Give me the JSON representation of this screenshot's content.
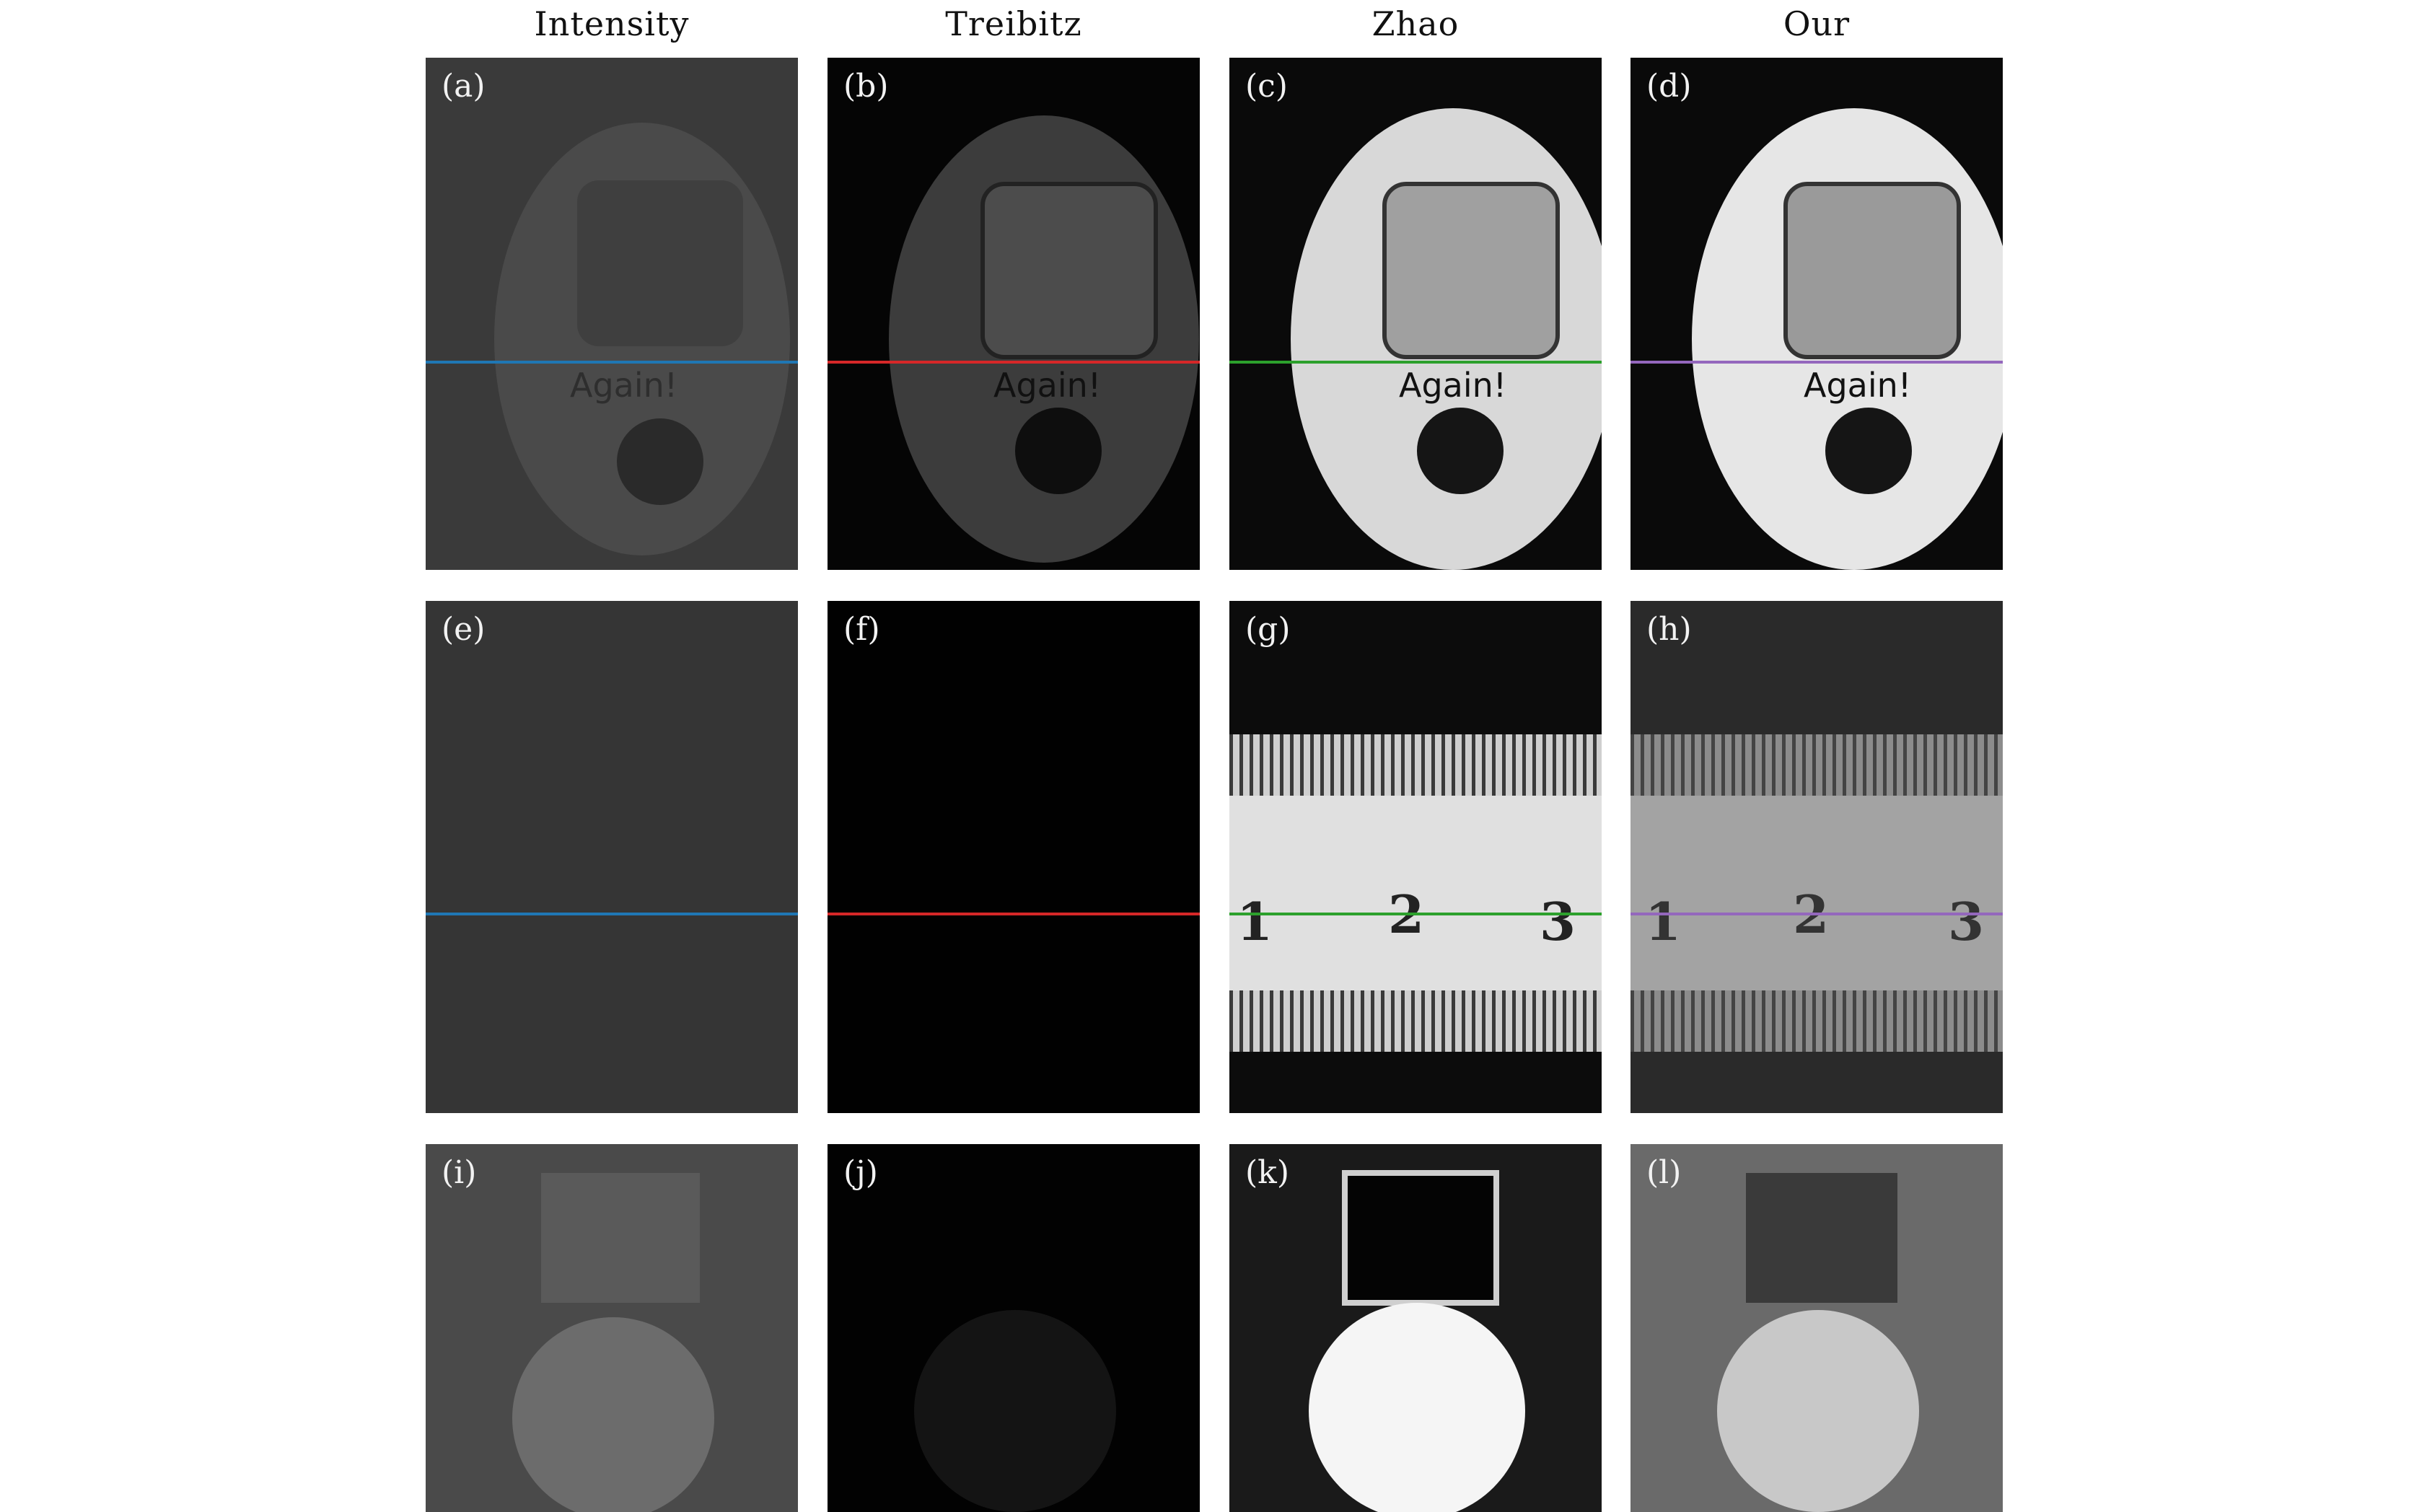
{
  "columns": [
    "Intensity",
    "Treibitz",
    "Zhao",
    "Our"
  ],
  "panels": [
    {
      "label": "(a)"
    },
    {
      "label": "(b)"
    },
    {
      "label": "(c)"
    },
    {
      "label": "(d)"
    },
    {
      "label": "(e)"
    },
    {
      "label": "(f)"
    },
    {
      "label": "(g)"
    },
    {
      "label": "(h)"
    },
    {
      "label": "(i)"
    },
    {
      "label": "(j)"
    },
    {
      "label": "(k)"
    },
    {
      "label": "(l)"
    }
  ],
  "keychain_text": "Again!",
  "ruler_numbers": [
    "1",
    "2",
    "3"
  ],
  "scanline_colors": [
    "#1f77b4",
    "#d62728",
    "#2ca02c",
    "#9467bd"
  ]
}
